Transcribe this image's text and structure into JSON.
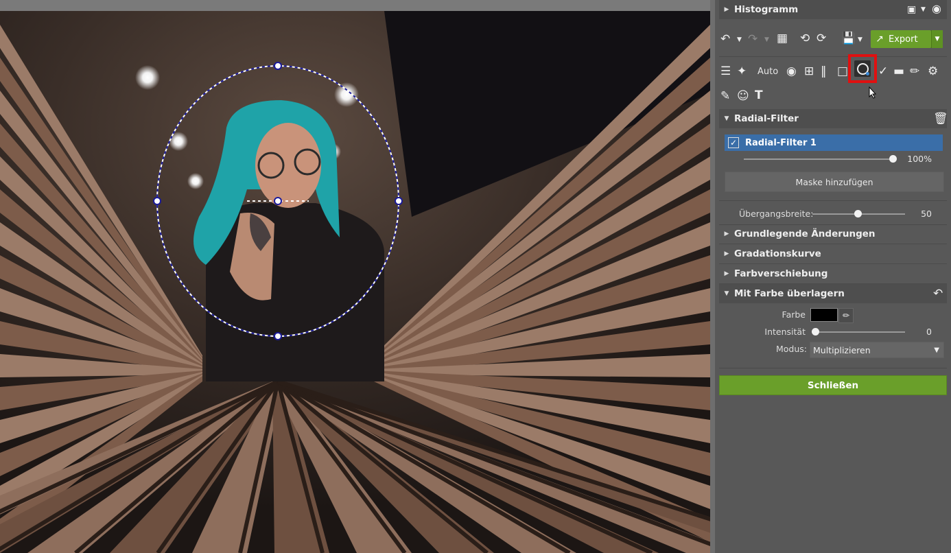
{
  "panel": {
    "histogram_label": "Histogramm",
    "toolbar": {
      "export_label": "Export",
      "auto_label": "Auto"
    },
    "radial_filter": {
      "title": "Radial-Filter",
      "layer_name": "Radial-Filter 1",
      "layer_checked": true,
      "opacity_value": "100%",
      "opacity_fraction": 1.0,
      "add_mask_label": "Maske hinzufügen",
      "feather_label": "Übergangsbreite:",
      "feather_value": "50",
      "feather_fraction": 0.5
    },
    "sections": [
      {
        "label": "Grundlegende Änderungen",
        "expanded": false
      },
      {
        "label": "Gradationskurve",
        "expanded": false
      },
      {
        "label": "Farbverschiebung",
        "expanded": false
      },
      {
        "label": "Mit Farbe überlagern",
        "expanded": true
      }
    ],
    "overlay": {
      "color_label": "Farbe",
      "color_value": "#000000",
      "intensity_label": "Intensität",
      "intensity_value": "0",
      "intensity_fraction": 0.0,
      "mode_label": "Modus:",
      "mode_value": "Multiplizieren"
    },
    "close_label": "Schließen"
  },
  "colors": {
    "accent_green": "#6a9f2a",
    "selection_blue": "#3a6ea8",
    "highlight_red": "#e01010",
    "mask_outline": "#ffffff"
  }
}
